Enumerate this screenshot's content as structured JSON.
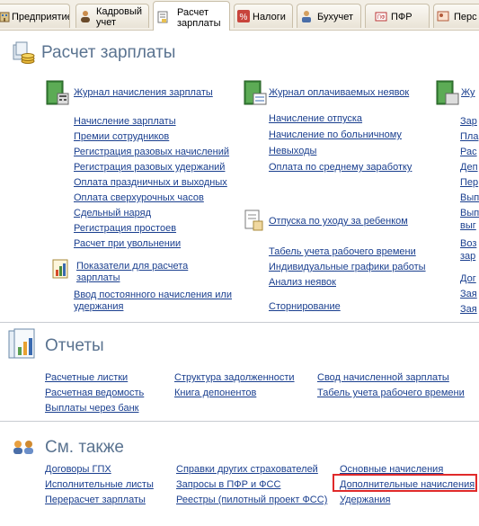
{
  "tabs": [
    {
      "label": "Предприятие"
    },
    {
      "label1": "Кадровый",
      "label2": "учет"
    },
    {
      "label1": "Расчет",
      "label2": "зарплаты"
    },
    {
      "label": "Налоги"
    },
    {
      "label": "Бухучет"
    },
    {
      "label": "ПФР"
    },
    {
      "label": "Перс"
    }
  ],
  "main": {
    "title": "Расчет зарплаты",
    "col1": {
      "journal": "Журнал начисления зарплаты",
      "links": [
        "Начисление зарплаты",
        "Премии сотрудников",
        "Регистрация разовых начислений",
        "Регистрация разовых удержаний",
        "Оплата праздничных и выходных",
        "Оплата сверхурочных часов",
        "Сдельный наряд",
        "Регистрация простоев",
        "Расчет при увольнении"
      ],
      "indicators": "Показатели для расчета зарплаты",
      "permanent": "Ввод постоянного начисления или удержания"
    },
    "col2": {
      "journal": "Журнал оплачиваемых неявок",
      "links": [
        "Начисление отпуска",
        "Начисление по больничному",
        "Невыходы",
        "Оплата по среднему заработку"
      ],
      "childcare": "Отпуска по уходу за ребенком",
      "links2": [
        "Табель учета рабочего времени",
        "Индивидуальные графики работы",
        "Анализ неявок"
      ],
      "storno": "Сторнирование"
    },
    "col3": {
      "journal": "Жу",
      "links": [
        "Зар",
        "Пла",
        "Рас",
        "Деп",
        "Пер",
        "Вып",
        "Вып",
        "выг",
        "Воз",
        "зар",
        "Дог",
        "Зая",
        "Зая"
      ]
    }
  },
  "reports": {
    "title": "Отчеты",
    "col1": [
      "Расчетные листки",
      "Расчетная ведомость",
      "Выплаты через банк"
    ],
    "col2": [
      "Структура задолженности",
      "Книга депонентов"
    ],
    "col3": [
      "Свод начисленной зарплаты",
      "Табель учета рабочего времени"
    ]
  },
  "seealso": {
    "title": "См. также",
    "col1": [
      "Договоры ГПХ",
      "Исполнительные листы",
      "Перерасчет зарплаты"
    ],
    "col2": [
      "Справки других страхователей",
      "Запросы в ПФР и ФСС",
      "Реестры (пилотный проект ФСС)"
    ],
    "col3": [
      "Основные начисления",
      "Дополнительные начисления",
      "Удержания"
    ]
  }
}
